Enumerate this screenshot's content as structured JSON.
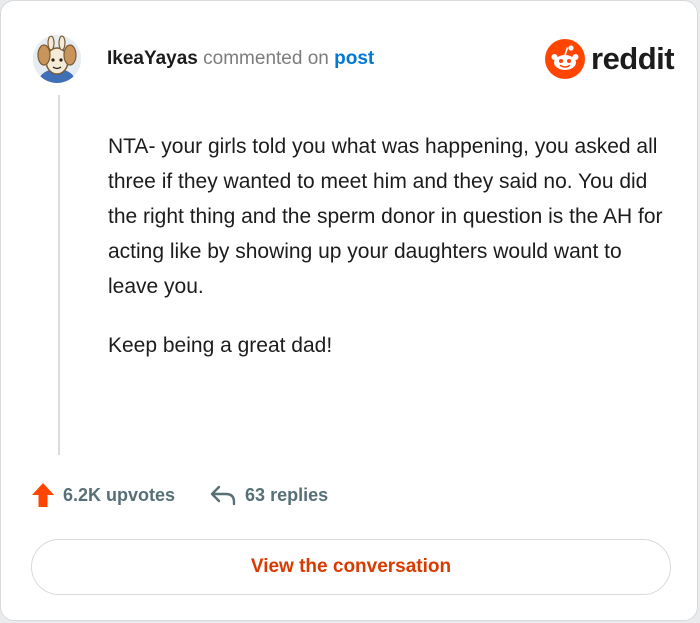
{
  "header": {
    "username": "IkeaYayas",
    "action_text": "commented on",
    "post_link": "post",
    "logo_text": "reddit"
  },
  "comment": {
    "paragraphs": [
      "NTA- your girls told you what was happening, you asked all three if they wanted to meet him and they said no. You did the right thing and the sperm donor in question is the AH for acting like by showing up your daughters would want to leave you.",
      "Keep being a great dad!"
    ]
  },
  "stats": {
    "upvotes": "6.2K upvotes",
    "replies": "63 replies"
  },
  "cta": {
    "label": "View the conversation"
  },
  "icons": {
    "avatar": "user-avatar",
    "logo": "reddit-logo-icon",
    "upvote": "upvote-arrow-icon",
    "reply": "reply-arrow-icon"
  },
  "colors": {
    "brand": "#ff4500",
    "link": "#0079d3",
    "cta_text": "#d93a00",
    "stat_text": "#576f76"
  }
}
